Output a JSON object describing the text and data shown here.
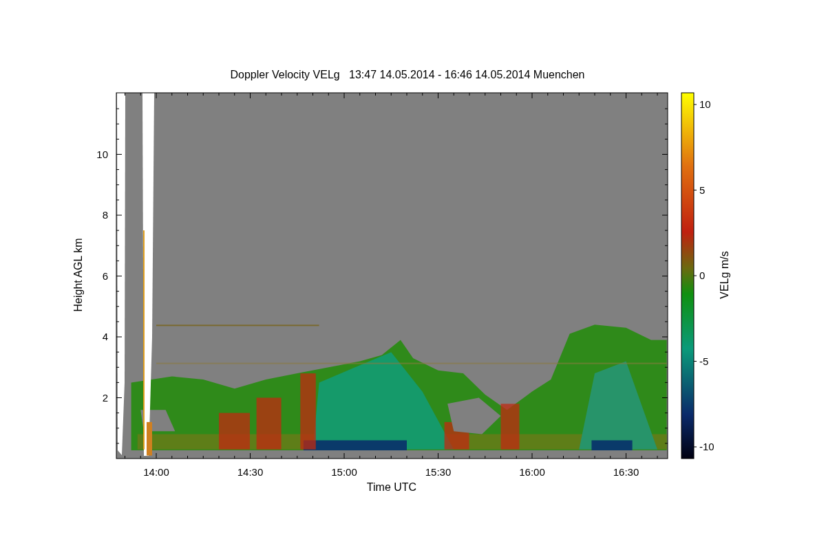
{
  "title": "Doppler Velocity VELg   13:47 14.05.2014 - 16:46 14.05.2014 Muenchen",
  "xlabel": "Time UTC",
  "ylabel": "Height AGL km",
  "xtick_labels": [
    "14:00",
    "14:30",
    "15:00",
    "15:30",
    "16:00",
    "16:30"
  ],
  "ytick_labels": [
    "10",
    "8",
    "6",
    "4",
    "2"
  ],
  "colorbar": {
    "label": "VELg m/s",
    "tick_labels": [
      "10",
      "5",
      "0",
      "-5",
      "-10"
    ]
  }
}
